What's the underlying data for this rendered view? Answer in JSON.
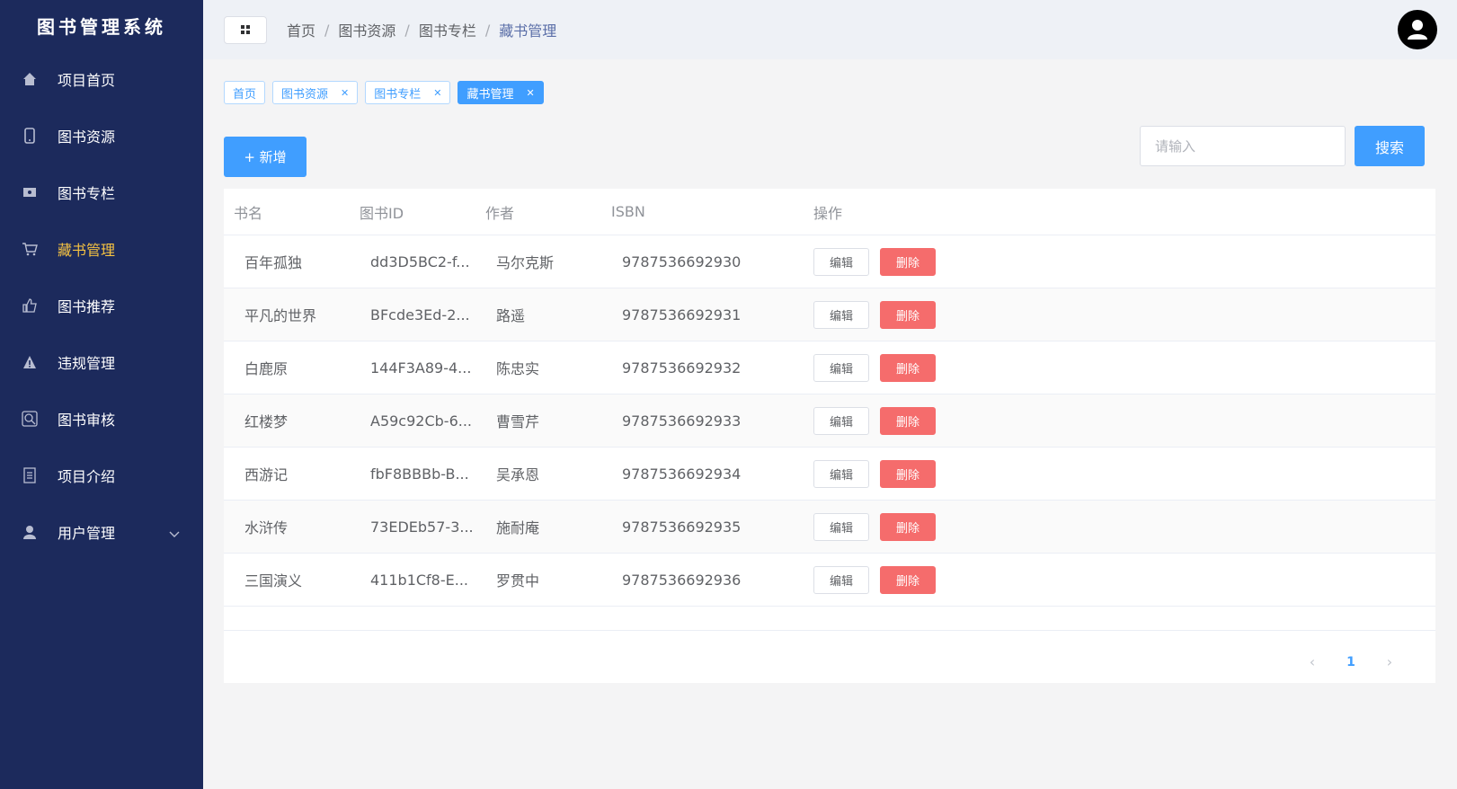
{
  "app": {
    "title": "图书管理系统"
  },
  "sidebar": {
    "items": [
      {
        "label": "项目首页",
        "icon": "home-icon"
      },
      {
        "label": "图书资源",
        "icon": "tablet-icon"
      },
      {
        "label": "图书专栏",
        "icon": "picture-icon"
      },
      {
        "label": "藏书管理",
        "icon": "cart-icon",
        "active": true
      },
      {
        "label": "图书推荐",
        "icon": "thumb-up-icon"
      },
      {
        "label": "违规管理",
        "icon": "warning-icon"
      },
      {
        "label": "图书审核",
        "icon": "zoom-icon"
      },
      {
        "label": "项目介绍",
        "icon": "document-icon"
      },
      {
        "label": "用户管理",
        "icon": "user-icon",
        "expandable": true
      }
    ]
  },
  "header": {
    "breadcrumb": [
      "首页",
      "图书资源",
      "图书专栏",
      "藏书管理"
    ]
  },
  "tags": [
    {
      "label": "首页",
      "closable": false,
      "active": false
    },
    {
      "label": "图书资源",
      "closable": true,
      "active": false
    },
    {
      "label": "图书专栏",
      "closable": true,
      "active": false
    },
    {
      "label": "藏书管理",
      "closable": true,
      "active": true
    }
  ],
  "toolbar": {
    "add_label": "+ 新增",
    "search_placeholder": "请输入",
    "search_value": "",
    "search_label": "搜索"
  },
  "table": {
    "columns": [
      "书名",
      "图书ID",
      "作者",
      "ISBN",
      "操作"
    ],
    "edit_label": "编辑",
    "delete_label": "删除",
    "rows": [
      {
        "name": "百年孤独",
        "id": "dd3D5BC2-f...",
        "author": "马尔克斯",
        "isbn": "9787536692930"
      },
      {
        "name": "平凡的世界",
        "id": "BFcde3Ed-2...",
        "author": "路遥",
        "isbn": "9787536692931"
      },
      {
        "name": "白鹿原",
        "id": "144F3A89-4...",
        "author": "陈忠实",
        "isbn": "9787536692932"
      },
      {
        "name": "红楼梦",
        "id": "A59c92Cb-6...",
        "author": "曹雪芹",
        "isbn": "9787536692933"
      },
      {
        "name": "西游记",
        "id": "fbF8BBBb-B...",
        "author": "吴承恩",
        "isbn": "9787536692934"
      },
      {
        "name": "水浒传",
        "id": "73EDEb57-3...",
        "author": "施耐庵",
        "isbn": "9787536692935"
      },
      {
        "name": "三国演义",
        "id": "411b1Cf8-E...",
        "author": "罗贯中",
        "isbn": "9787536692936"
      }
    ]
  },
  "pagination": {
    "current": "1",
    "prev_icon": "chevron-left-icon",
    "next_icon": "chevron-right-icon"
  },
  "colors": {
    "sidebar": "#1c2a5c",
    "primary": "#409eff",
    "danger": "#f56c6c",
    "active_menu": "#f5c242"
  }
}
